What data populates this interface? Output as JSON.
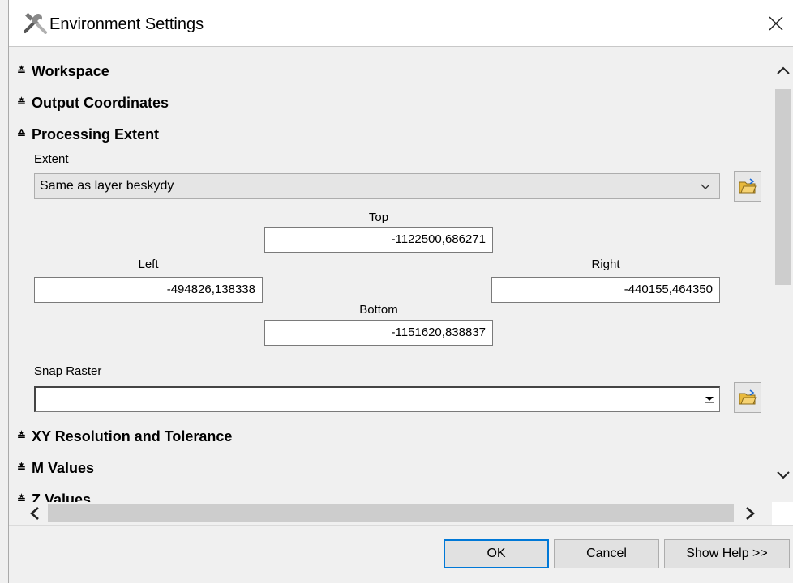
{
  "window": {
    "title": "Environment Settings"
  },
  "sections": {
    "workspace": "Workspace",
    "output_coordinates": "Output Coordinates",
    "processing_extent": "Processing Extent",
    "xy_resolution": "XY Resolution and Tolerance",
    "m_values": "M Values",
    "z_values": "Z Values"
  },
  "extent": {
    "label": "Extent",
    "selected": "Same as layer beskydy",
    "top_label": "Top",
    "top": "-1122500,686271",
    "left_label": "Left",
    "left": "-494826,138338",
    "right_label": "Right",
    "right": "-440155,464350",
    "bottom_label": "Bottom",
    "bottom": "-1151620,838837"
  },
  "snap_raster": {
    "label": "Snap Raster",
    "value": ""
  },
  "buttons": {
    "ok": "OK",
    "cancel": "Cancel",
    "show_help": "Show Help >>"
  },
  "colors": {
    "accent": "#0078d7",
    "folder": "#e8b93c"
  }
}
